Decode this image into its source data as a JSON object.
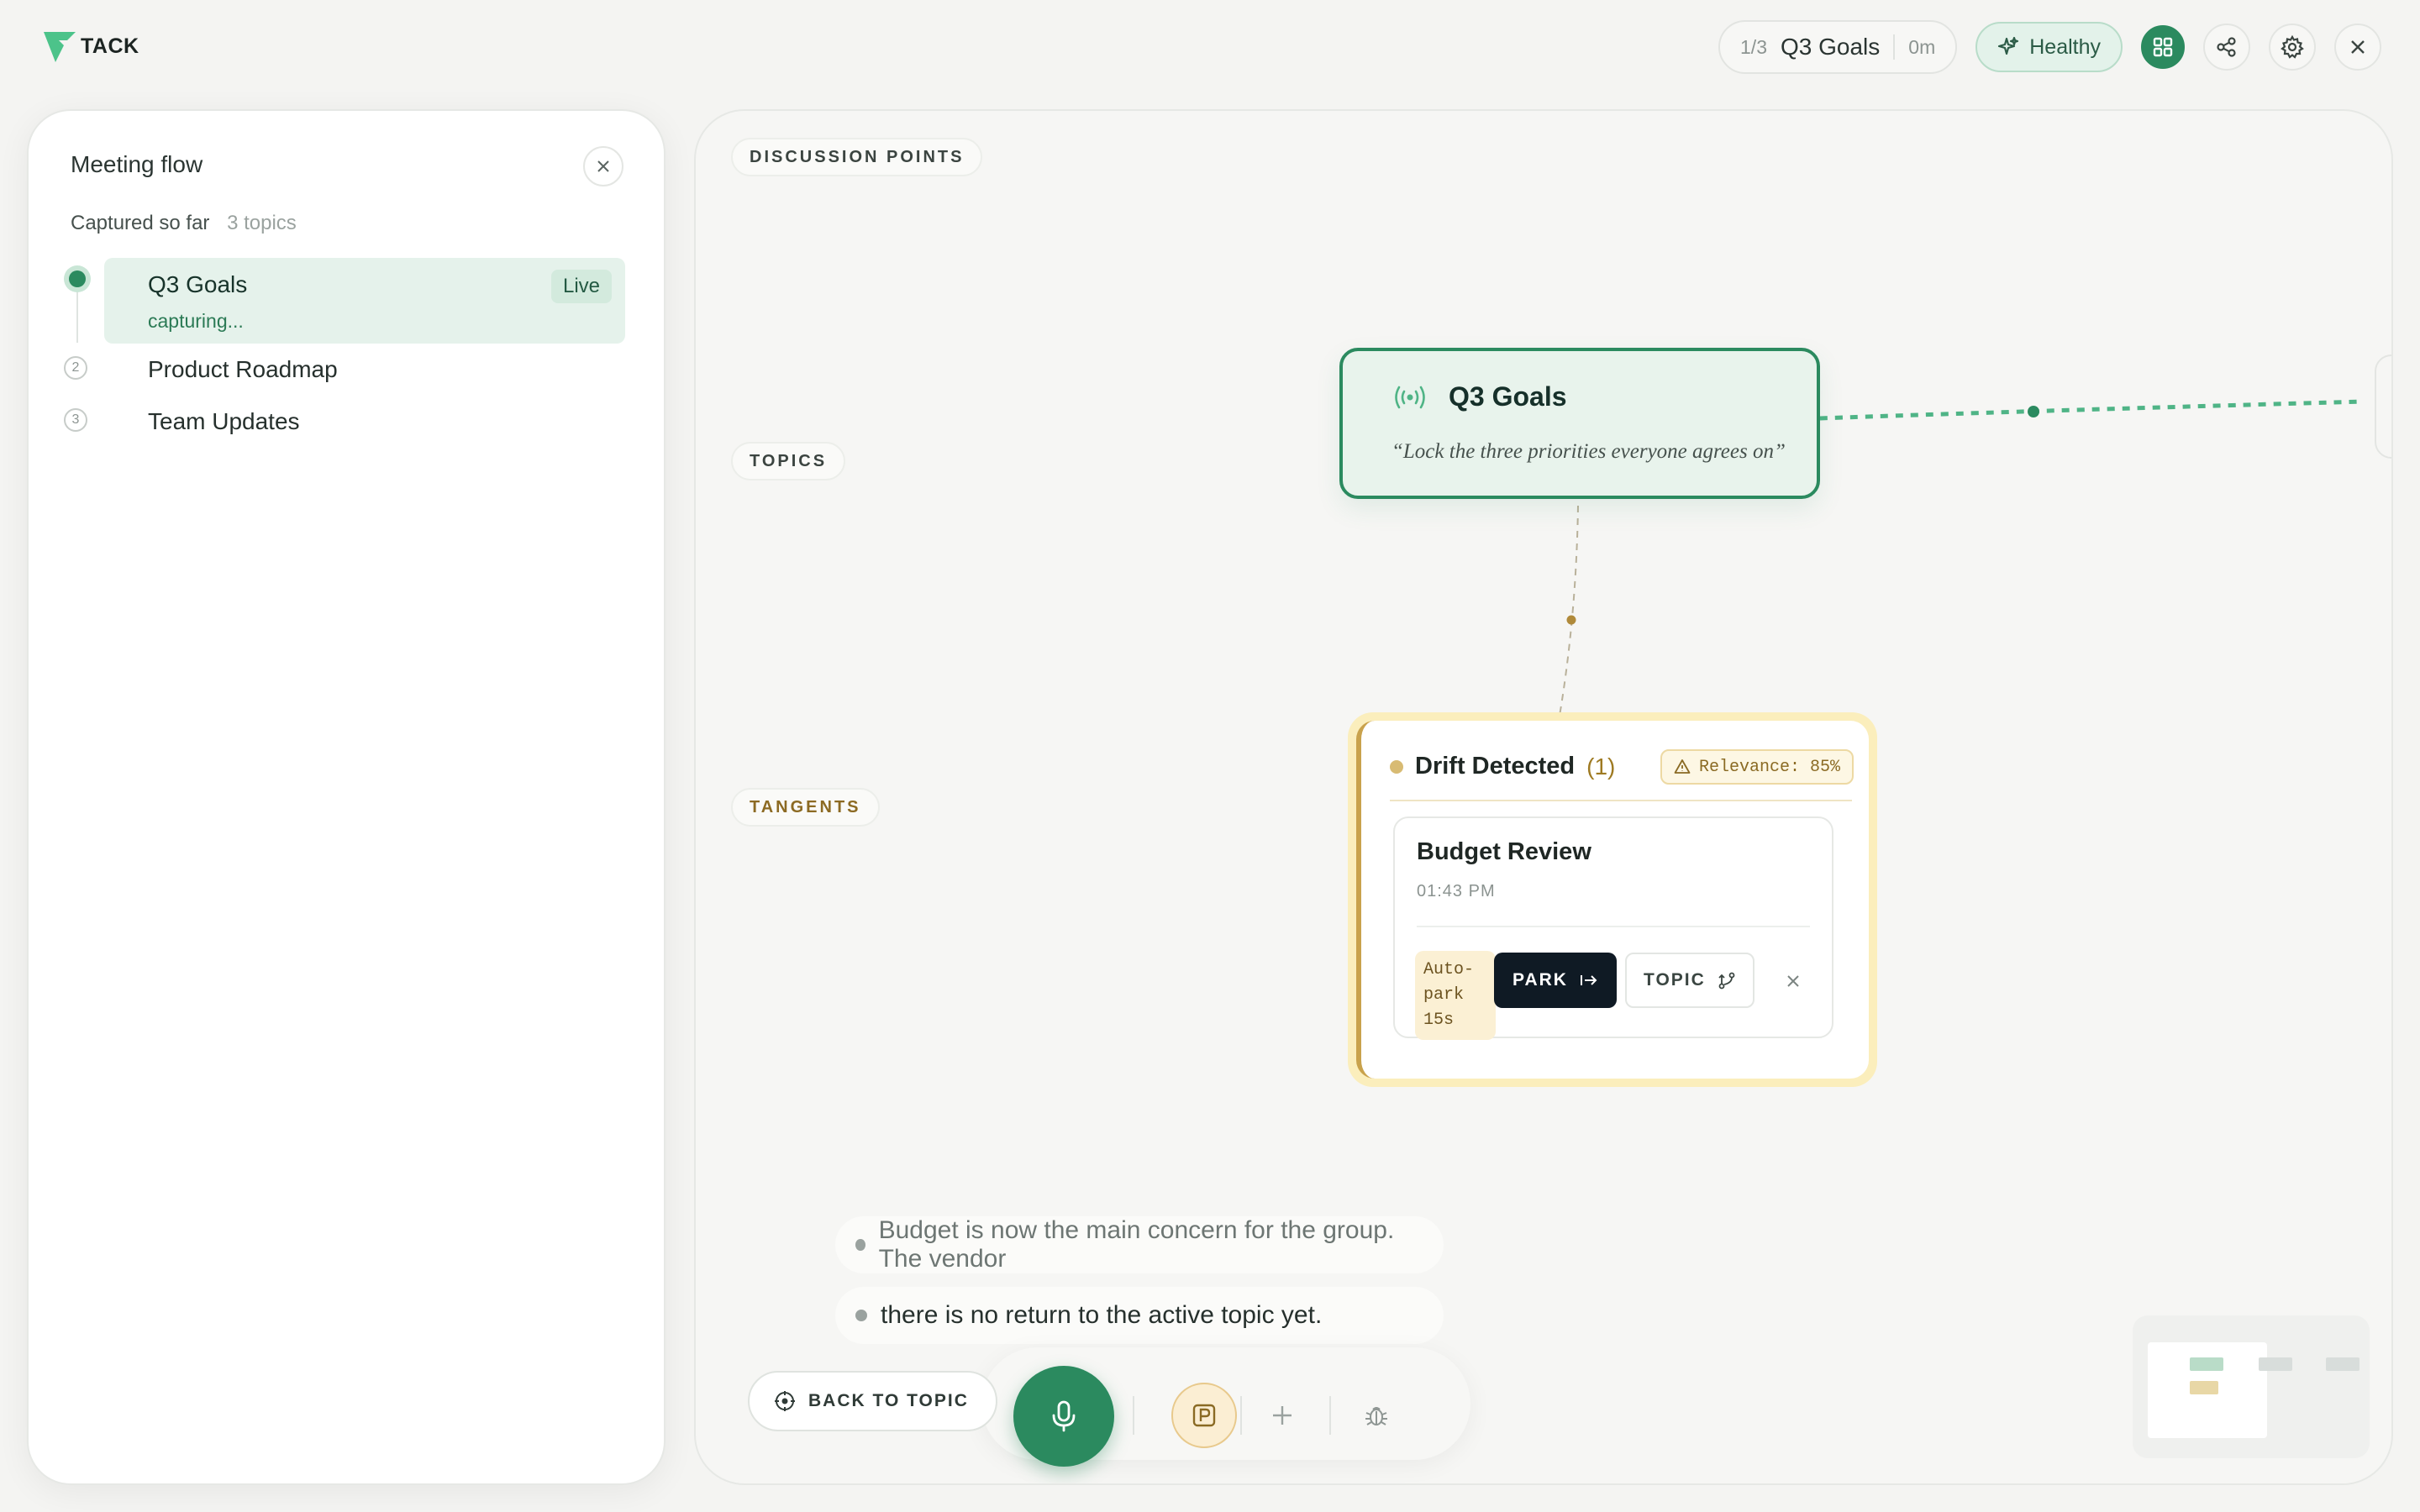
{
  "app": {
    "brand": "TACK",
    "brand_color": "#4cc38a"
  },
  "header": {
    "progress": "1/3",
    "meeting_title": "Q3 Goals",
    "elapsed": "0m",
    "health_label": "Healthy",
    "icons": [
      "sparkles-icon",
      "grid-icon",
      "share-icon",
      "gear-icon",
      "close-icon"
    ]
  },
  "sidebar": {
    "title": "Meeting flow",
    "captured_label": "Captured so far",
    "captured_count": "3 topics",
    "topics": [
      {
        "index": "1",
        "label": "Q3 Goals",
        "status": "capturing...",
        "badge": "Live"
      },
      {
        "index": "2",
        "label": "Product Roadmap"
      },
      {
        "index": "3",
        "label": "Team Updates"
      }
    ]
  },
  "canvas": {
    "lanes": {
      "discussion": "DISCUSSION POINTS",
      "topics": "TOPICS",
      "tangents": "TANGENTS"
    },
    "topic_card": {
      "title": "Q3 Goals",
      "quote": "“Lock the three priorities everyone agrees on”"
    },
    "drift": {
      "title": "Drift Detected",
      "count": "(1)",
      "relevance": "Relevance: 85%",
      "tangent": {
        "title": "Budget Review",
        "time": "01:43 PM",
        "autopark": "Auto-park 15s",
        "park_label": "PARK",
        "topic_label": "TOPIC"
      }
    },
    "transcript": [
      "Budget is now the main concern for the group. The vendor",
      "there is no return to the active topic yet."
    ],
    "controls": {
      "back_to_topic": "BACK TO TOPIC"
    }
  },
  "colors": {
    "accent_green": "#2b8a5f",
    "drift_amber": "#fbeebc",
    "park_button": "#0f1a24"
  }
}
